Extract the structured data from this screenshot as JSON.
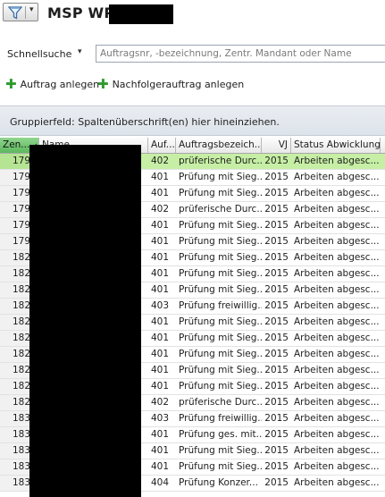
{
  "header": {
    "title": "MSP WP",
    "filter_icon": "funnel-icon",
    "dropdown_glyph": "▾"
  },
  "search": {
    "label": "Schnellsuche",
    "dropdown_glyph": "▾",
    "placeholder": "Auftragsnr, -bezeichnung, Zentr. Mandant oder Name"
  },
  "actions": {
    "create_order": "Auftrag anlegen",
    "create_followup": "Nachfolgerauftrag anlegen",
    "plus_glyph": "✚"
  },
  "grouping": {
    "hint": "Gruppierfeld: Spaltenüberschrift(en) hier hineinziehen."
  },
  "grid": {
    "columns": {
      "zentr": "Zen...",
      "name": "Name",
      "auf": "Auf...",
      "bezeichnung": "Auftragsbezeich...",
      "vj": "VJ",
      "status": "Status Abwicklung"
    },
    "rows": [
      {
        "zentr": "179",
        "auf": "402",
        "bez": "prüferische Durc...",
        "vj": "2015",
        "status": "Arbeiten abgesc..."
      },
      {
        "zentr": "179",
        "auf": "401",
        "bez": "Prüfung mit Sieg...",
        "vj": "2015",
        "status": "Arbeiten abgesc..."
      },
      {
        "zentr": "179",
        "auf": "401",
        "bez": "Prüfung mit Sieg...",
        "vj": "2015",
        "status": "Arbeiten abgesc..."
      },
      {
        "zentr": "179",
        "auf": "402",
        "bez": "prüferische Durc...",
        "vj": "2015",
        "status": "Arbeiten abgesc..."
      },
      {
        "zentr": "179",
        "auf": "401",
        "bez": "Prüfung mit Sieg...",
        "vj": "2015",
        "status": "Arbeiten abgesc..."
      },
      {
        "zentr": "179",
        "auf": "401",
        "bez": "Prüfung mit Sieg...",
        "vj": "2015",
        "status": "Arbeiten abgesc..."
      },
      {
        "zentr": "182",
        "auf": "401",
        "bez": "Prüfung mit Sieg...",
        "vj": "2015",
        "status": "Arbeiten abgesc..."
      },
      {
        "zentr": "182",
        "auf": "401",
        "bez": "Prüfung mit Sieg...",
        "vj": "2015",
        "status": "Arbeiten abgesc..."
      },
      {
        "zentr": "182",
        "auf": "401",
        "bez": "Prüfung mit Sieg...",
        "vj": "2015",
        "status": "Arbeiten abgesc..."
      },
      {
        "zentr": "182",
        "auf": "403",
        "bez": "Prüfung freiwillig...",
        "vj": "2015",
        "status": "Arbeiten abgesc..."
      },
      {
        "zentr": "182",
        "auf": "401",
        "bez": "Prüfung mit Sieg...",
        "vj": "2015",
        "status": "Arbeiten abgesc..."
      },
      {
        "zentr": "182",
        "auf": "401",
        "bez": "Prüfung mit Sieg...",
        "vj": "2015",
        "status": "Arbeiten abgesc..."
      },
      {
        "zentr": "182",
        "auf": "401",
        "bez": "Prüfung mit Sieg...",
        "vj": "2015",
        "status": "Arbeiten abgesc..."
      },
      {
        "zentr": "182",
        "auf": "401",
        "bez": "Prüfung mit Sieg...",
        "vj": "2015",
        "status": "Arbeiten abgesc..."
      },
      {
        "zentr": "182",
        "auf": "401",
        "bez": "Prüfung mit Sieg...",
        "vj": "2015",
        "status": "Arbeiten abgesc..."
      },
      {
        "zentr": "182",
        "auf": "402",
        "bez": "prüferische Durc...",
        "vj": "2015",
        "status": "Arbeiten abgesc..."
      },
      {
        "zentr": "183",
        "auf": "403",
        "bez": "Prüfung freiwillig...",
        "vj": "2015",
        "status": "Arbeiten abgesc..."
      },
      {
        "zentr": "183",
        "auf": "401",
        "bez": "Prüfung ges. mit...",
        "vj": "2015",
        "status": "Arbeiten abgesc..."
      },
      {
        "zentr": "183",
        "auf": "401",
        "bez": "Prüfung mit Sieg...",
        "vj": "2015",
        "status": "Arbeiten abgesc..."
      },
      {
        "zentr": "183",
        "auf": "401",
        "bez": "Prüfung mit Sieg...",
        "vj": "2015",
        "status": "Arbeiten abgesc..."
      },
      {
        "zentr": "183",
        "auf": "404",
        "bez": "Prüfung Konzer...",
        "vj": "2015",
        "status": "Arbeiten abgesc..."
      }
    ]
  },
  "colors": {
    "selected_row": "#c6efa5",
    "sorted_header": "#5cb85c",
    "plus_icon": "#2e9a2e"
  }
}
